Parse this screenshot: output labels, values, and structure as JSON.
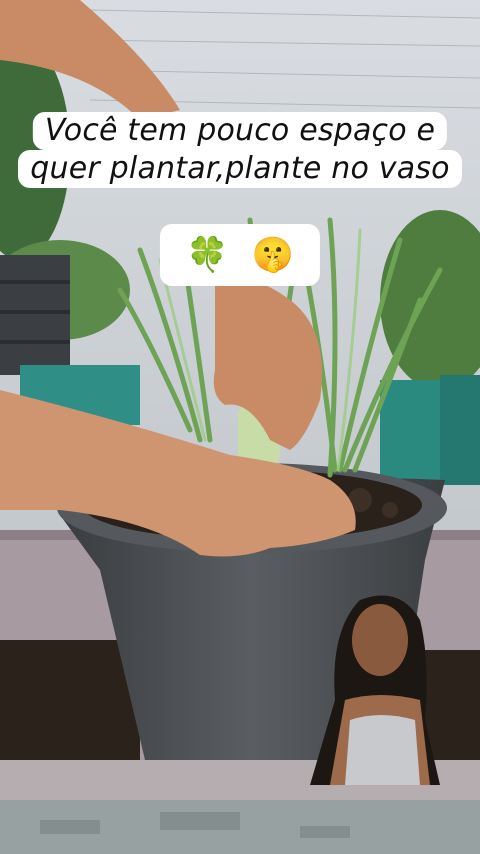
{
  "caption": {
    "line1": "Você tem pouco espaço e",
    "line2": "quer plantar,plante no vaso",
    "emoji_1": "🍀",
    "emoji_2": "🤫"
  },
  "colors": {
    "caption_bg": "#ffffff",
    "caption_text": "#111111",
    "pot": "#4a4e52",
    "soil": "#2a211b",
    "onion_greens": "#7fae6a",
    "planter": "#a79aa0",
    "skin": "#c98b66"
  }
}
